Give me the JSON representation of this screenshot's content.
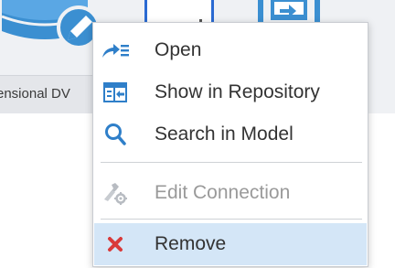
{
  "background": {
    "tile_caption": "ensional DV",
    "selected_tile_color": "#2a6ad2",
    "icon_color": "#3b8fd1"
  },
  "context_menu": {
    "items": [
      {
        "label": "Open",
        "icon": "open-arrow-icon",
        "enabled": true
      },
      {
        "label": "Show in Repository",
        "icon": "show-in-repository-icon",
        "enabled": true
      },
      {
        "label": "Search in Model",
        "icon": "search-icon",
        "enabled": true
      },
      {
        "label": "Edit Connection",
        "icon": "edit-connection-gear-icon",
        "enabled": false
      },
      {
        "label": "Remove",
        "icon": "remove-x-icon",
        "enabled": true,
        "highlighted": true
      }
    ],
    "highlight_color": "#d4e6f7",
    "remove_icon_color": "#d93a3a"
  }
}
